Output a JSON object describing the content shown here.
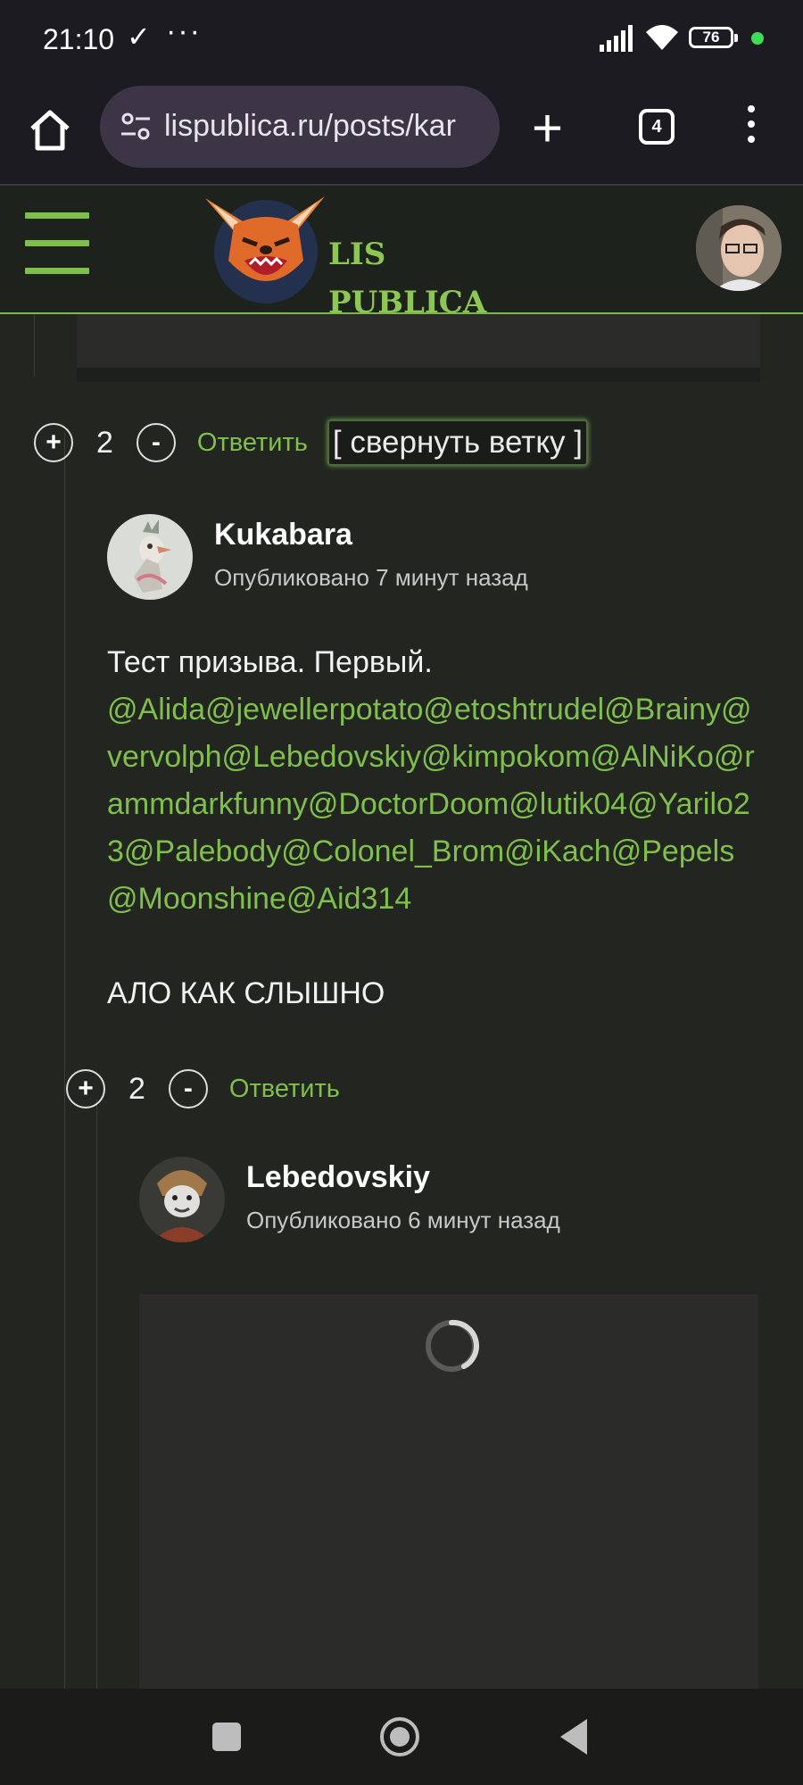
{
  "status_bar": {
    "time": "21:10",
    "check_glyph": "✓",
    "more_glyph": "···",
    "battery": "76"
  },
  "browser": {
    "url": "lispublica.ru/posts/kar",
    "tab_count": "4",
    "new_tab_glyph": "+"
  },
  "site": {
    "logo_line1": "LIS",
    "logo_line2": "PUBLICA",
    "accent_color": "#7fbf4c"
  },
  "thread": {
    "parent_votes": {
      "plus": "+",
      "count": "2",
      "minus": "-",
      "reply_label": "Ответить",
      "collapse_label": "[ свернуть ветку ]"
    },
    "comment1": {
      "author": "Kukabara",
      "published": "Опубликовано 7 минут назад",
      "text_intro": "Тест призыва. Первый.",
      "mentions": "@Alida@jewellerpotato@etoshtrudel@Brainy@vervolph@Lebedovskiy@kimpokom@AlNiKo@rammdarkfunny@DoctorDoom@lutik04@Yarilo23@Palebody@Colonel_Brom@iKach@Pepels@Moonshine@Aid314",
      "text_outro": "АЛО КАК СЛЫШНО",
      "votes": {
        "plus": "+",
        "count": "2",
        "minus": "-",
        "reply_label": "Ответить"
      }
    },
    "comment2": {
      "author": "Lebedovskiy",
      "published": "Опубликовано 6 минут назад"
    }
  }
}
